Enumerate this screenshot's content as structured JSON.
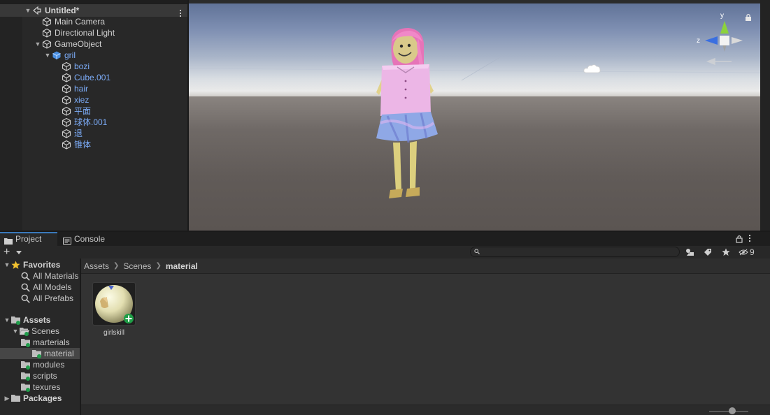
{
  "hierarchy": {
    "scene_name": "Untitled*",
    "items": [
      {
        "label": "Main Camera"
      },
      {
        "label": "Directional Light"
      },
      {
        "label": "GameObject"
      },
      {
        "label": "gril"
      },
      {
        "label": "bozi"
      },
      {
        "label": "Cube.001"
      },
      {
        "label": "hair"
      },
      {
        "label": "xiez"
      },
      {
        "label": "平面"
      },
      {
        "label": "球体.001"
      },
      {
        "label": "退"
      },
      {
        "label": "锥体"
      }
    ]
  },
  "scene_view": {
    "gizmo_axes": {
      "y": "y",
      "z": "z"
    }
  },
  "bottom_tabs": [
    {
      "label": "Project",
      "icon": "folder-icon",
      "active": true
    },
    {
      "label": "Console",
      "icon": "console-icon",
      "active": false
    }
  ],
  "project_toolbar": {
    "add_label": "+",
    "search_placeholder": "",
    "hidden_count": "9"
  },
  "project_tree": {
    "favorites_label": "Favorites",
    "favorites": [
      {
        "label": "All Materials"
      },
      {
        "label": "All Models"
      },
      {
        "label": "All Prefabs"
      }
    ],
    "assets_label": "Assets",
    "scenes_label": "Scenes",
    "scene_folders": [
      {
        "label": "marterials",
        "selected": false
      },
      {
        "label": "material",
        "selected": true
      },
      {
        "label": "modules",
        "selected": false
      },
      {
        "label": "scripts",
        "selected": false
      },
      {
        "label": "texures",
        "selected": false
      }
    ],
    "packages_label": "Packages"
  },
  "breadcrumb": {
    "parts": [
      "Assets",
      "Scenes"
    ],
    "current": "material"
  },
  "assets": [
    {
      "name": "girlskill",
      "icon": "material-sphere-icon"
    }
  ],
  "colors": {
    "accent": "#3a79bb",
    "prefab_blue": "#7cacf8",
    "selection": "#464646"
  }
}
